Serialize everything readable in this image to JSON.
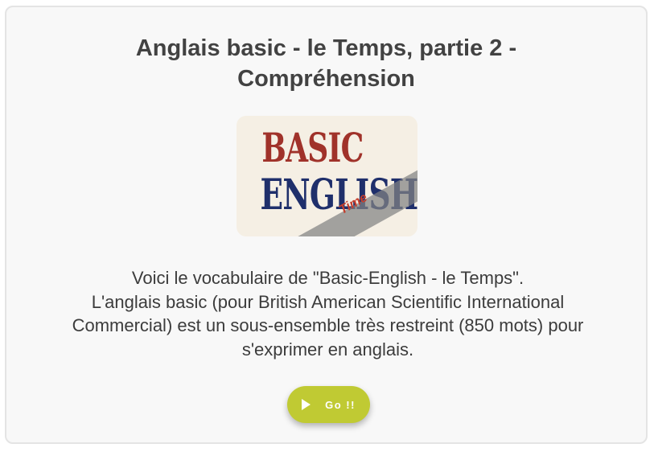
{
  "title": {
    "line1": "Anglais basic - le Temps, partie 2 -",
    "line2": "Compréhension"
  },
  "logo": {
    "line1": "BASIC",
    "line2": "ENGLISH",
    "badge": "Time"
  },
  "description": {
    "line1": "Voici le vocabulaire de \"Basic-English - le Temps\".",
    "line2": "L'anglais basic (pour British American Scientific International",
    "line3": "Commercial) est un sous-ensemble très restreint (850 mots) pour",
    "line4": "s'exprimer en anglais."
  },
  "go_button": {
    "label": "Go !!",
    "icon": "play-icon",
    "color": "#c0ca33"
  }
}
